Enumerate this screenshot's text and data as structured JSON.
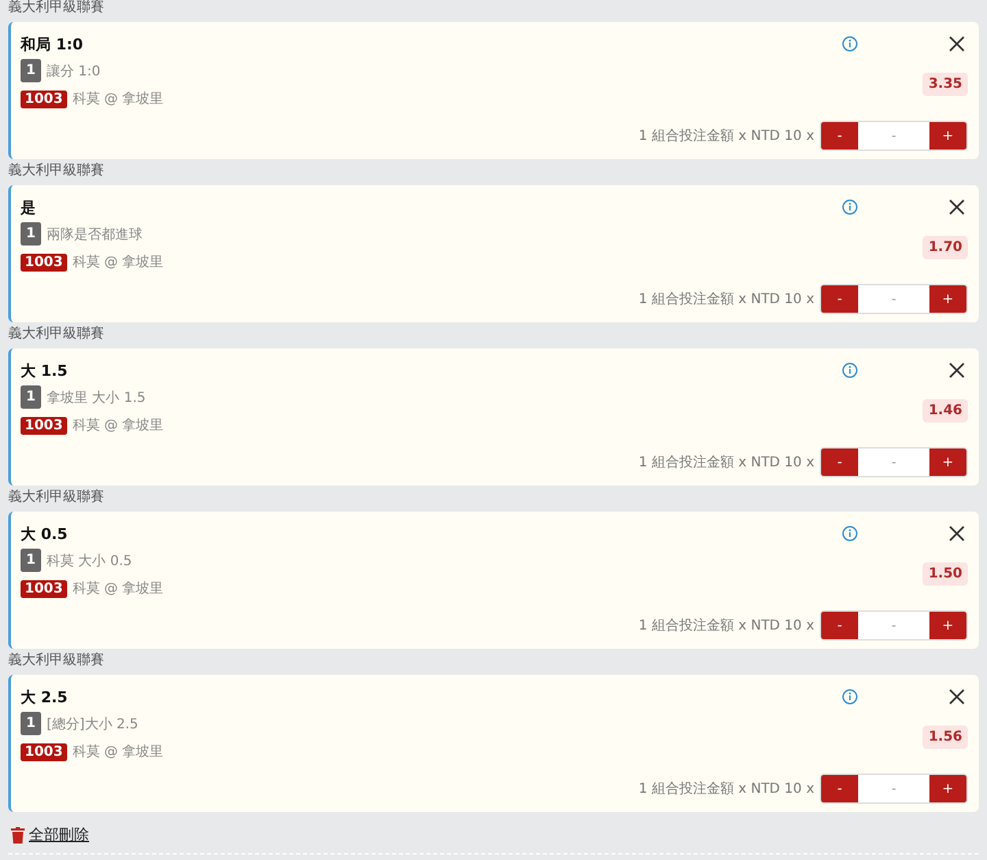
{
  "bets": [
    {
      "league": "義大利甲級聯賽",
      "selection": "和局 1:0",
      "leg": "1",
      "market": "讓分 1:0",
      "match_no": "1003",
      "match": "科莫 @ 拿坡里",
      "odds": "3.35",
      "stake_label": "1 組合投注金額 x NTD 10 x",
      "minus": "-",
      "placeholder": "-",
      "plus": "+"
    },
    {
      "league": "義大利甲級聯賽",
      "selection": "是",
      "leg": "1",
      "market": "兩隊是否都進球",
      "match_no": "1003",
      "match": "科莫 @ 拿坡里",
      "odds": "1.70",
      "stake_label": "1 組合投注金額 x NTD 10 x",
      "minus": "-",
      "placeholder": "-",
      "plus": "+"
    },
    {
      "league": "義大利甲級聯賽",
      "selection": "大 1.5",
      "leg": "1",
      "market": "拿坡里 大小 1.5",
      "match_no": "1003",
      "match": "科莫 @ 拿坡里",
      "odds": "1.46",
      "stake_label": "1 組合投注金額 x NTD 10 x",
      "minus": "-",
      "placeholder": "-",
      "plus": "+"
    },
    {
      "league": "義大利甲級聯賽",
      "selection": "大 0.5",
      "leg": "1",
      "market": "科莫 大小 0.5",
      "match_no": "1003",
      "match": "科莫 @ 拿坡里",
      "odds": "1.50",
      "stake_label": "1 組合投注金額 x NTD 10 x",
      "minus": "-",
      "placeholder": "-",
      "plus": "+"
    },
    {
      "league": "義大利甲級聯賽",
      "selection": "大 2.5",
      "leg": "1",
      "market": "[總分]大小 2.5",
      "match_no": "1003",
      "match": "科莫 @ 拿坡里",
      "odds": "1.56",
      "stake_label": "1 組合投注金額 x NTD 10 x",
      "minus": "-",
      "placeholder": "-",
      "plus": "+"
    }
  ],
  "delete_all": "全部刪除"
}
